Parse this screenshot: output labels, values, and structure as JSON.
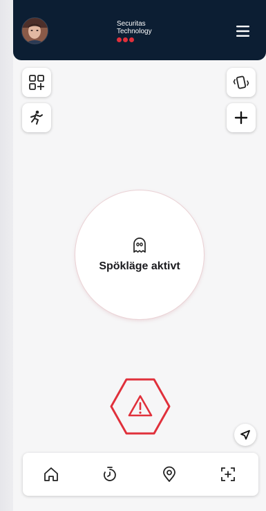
{
  "header": {
    "brand_line1": "Securitas",
    "brand_line2": "Technology",
    "brand_color": "#e0303b",
    "background_color": "#0c1e33",
    "avatar_icon": "user-avatar",
    "menu_icon": "hamburger-menu-icon"
  },
  "toolbar": {
    "left_top_icon": "dashboard-add-icon",
    "left_bottom_icon": "fall-detection-icon",
    "right_top_icon": "vibrate-phone-icon",
    "right_bottom_icon": "plus-icon"
  },
  "main": {
    "status_icon": "ghost-icon",
    "status_label": "Spökläge aktivt"
  },
  "alarm": {
    "icon": "warning-hexagon-icon",
    "color": "#e0303b"
  },
  "bottom_nav": {
    "items": [
      {
        "icon": "home-icon"
      },
      {
        "icon": "timer-icon"
      },
      {
        "icon": "location-pin-icon"
      },
      {
        "icon": "scan-add-icon"
      }
    ]
  }
}
